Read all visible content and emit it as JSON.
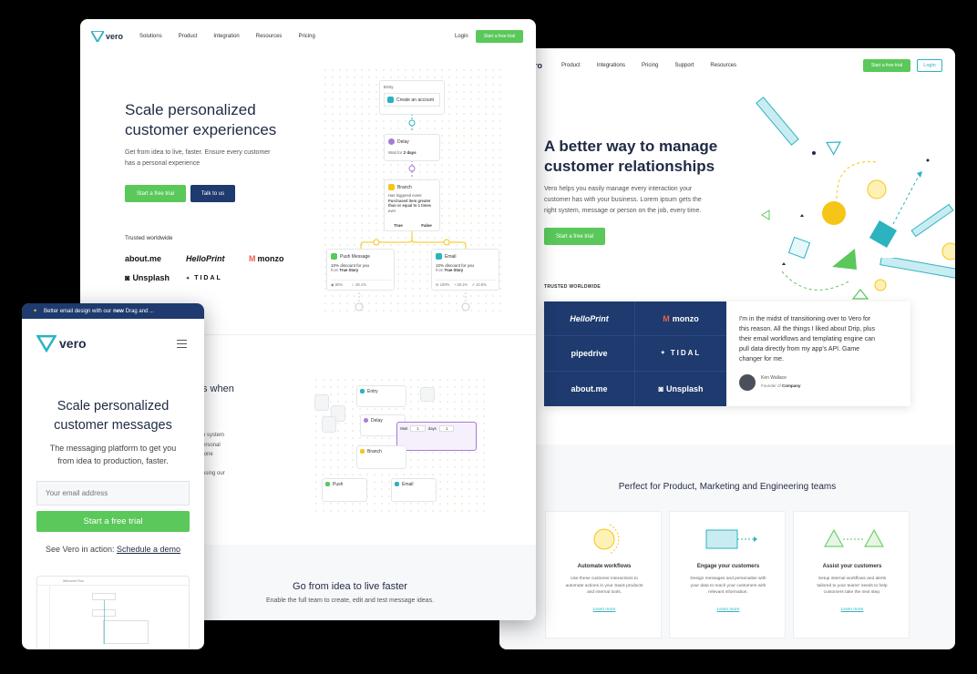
{
  "colors": {
    "green": "#5ac85a",
    "navy": "#1e3a6e",
    "teal": "#2bb3c0",
    "yellow": "#f5c518",
    "purple": "#a57cd6",
    "bg": "#000000"
  },
  "w1": {
    "brand": "vero",
    "nav": [
      "Solutions",
      "Product",
      "Integration",
      "Resources",
      "Pricing"
    ],
    "login": "Login",
    "cta": "Start a free trial",
    "hero_title_1": "Scale personalized",
    "hero_title_2": "customer experiences",
    "hero_sub_1": "Get from idea to live, faster. Ensure every customer",
    "hero_sub_2": "has a personal experience",
    "btn_trial": "Start a free trial",
    "btn_talk": "Talk to us",
    "trusted": "Trusted worldwide",
    "logos": [
      "about.me",
      "HelloPrint",
      "monzo",
      "Unsplash",
      "TIDAL"
    ],
    "flow": {
      "entry_label": "Entry",
      "entry_action": "Create an account",
      "delay_label": "Delay",
      "delay_text": "Wait for",
      "delay_value": "2 days",
      "branch_label": "Branch",
      "branch_text_1": "Has triggered event",
      "branch_text_2": "Purchased item greater",
      "branch_text_3": "than or equal to 1 times",
      "branch_text_4": "ever",
      "true": "True",
      "false": "False",
      "push_label": "Push Message",
      "push_line": "10% discount for you",
      "push_from": "from",
      "push_from_val": "True Story",
      "push_stat1": "80%",
      "push_stat2": "28.1%",
      "email_label": "Email",
      "email_line": "10% discount for you",
      "email_from": "from",
      "email_from_val": "True Story",
      "email_stat1": "100%",
      "email_stat2": "28.1%",
      "email_stat3": "10.8%"
    },
    "sec2_partial": "s when",
    "sec2_lines": [
      "n system",
      "ersonal",
      "tone",
      "using our"
    ],
    "flow2": {
      "entry": "Entry",
      "delay": "Delay",
      "branch": "Branch",
      "push": "Push",
      "email": "Email",
      "wait": "Wait",
      "days": "days",
      "n1": "1",
      "n2": "1"
    },
    "sec3_title": "Go from idea to live faster",
    "sec3_sub": "Enable the full team to create, edit and test message ideas."
  },
  "w2": {
    "brand": "vero",
    "nav": [
      "Product",
      "Integrations",
      "Pricing",
      "Support",
      "Resources"
    ],
    "cta": "Start a free trial",
    "login": "Login",
    "hero_title_1": "A better way to manage",
    "hero_title_2": "customer relationships",
    "hero_sub_1": "Vero helps you easily manage every interaction your",
    "hero_sub_2": "customer has with your business. Lorem ipsum gets the",
    "hero_sub_3": "right system, message or person on the job, every time.",
    "btn_trial": "Start a free trial",
    "trusted": "TRUSTED WORLDWIDE",
    "logos": [
      "HelloPrint",
      "monzo",
      "pipedrive",
      "TIDAL",
      "about.me",
      "Unsplash"
    ],
    "quote_1": "I'm in the midst of transitioning over to Vero for",
    "quote_2": "this reason. All the things I liked about Drip, plus",
    "quote_3": "their email workflows and templating engine can",
    "quote_4": "pull data directly from my app's API. Game",
    "quote_5": "changer for me.",
    "author": "Ken Wallace",
    "author_role": "Founder of",
    "author_company": "Company",
    "teams_title": "Perfect for Product, Marketing and Engineering teams",
    "features": [
      {
        "title": "Automate workflows",
        "l1": "Use these customer interactions to",
        "l2": "automate actions in your SaaS products",
        "l3": "and internal tools.",
        "link": "Learn more"
      },
      {
        "title": "Engage your customers",
        "l1": "Design messages and personalise with",
        "l2": "your data to reach your customers with",
        "l3": "relevant information.",
        "link": "Learn more"
      },
      {
        "title": "Assist your customers",
        "l1": "Setup internal workflows and alerts",
        "l2": "tailored to your teams' needs to help",
        "l3": "customers take the next step.",
        "link": "Learn more"
      }
    ]
  },
  "w3": {
    "banner_pre": "Better email design with our ",
    "banner_bold": "new",
    "banner_post": " Drag and ...",
    "brand": "vero",
    "title_1": "Scale personalized",
    "title_2": "customer messages",
    "sub_1": "The messaging platform to get you",
    "sub_2": "from idea to production, faster.",
    "email_placeholder": "Your email address",
    "btn_trial": "Start a free trial",
    "action_pre": "See Vero in action: ",
    "action_link": "Schedule a demo",
    "preview_tab": "Welcome Flow"
  }
}
